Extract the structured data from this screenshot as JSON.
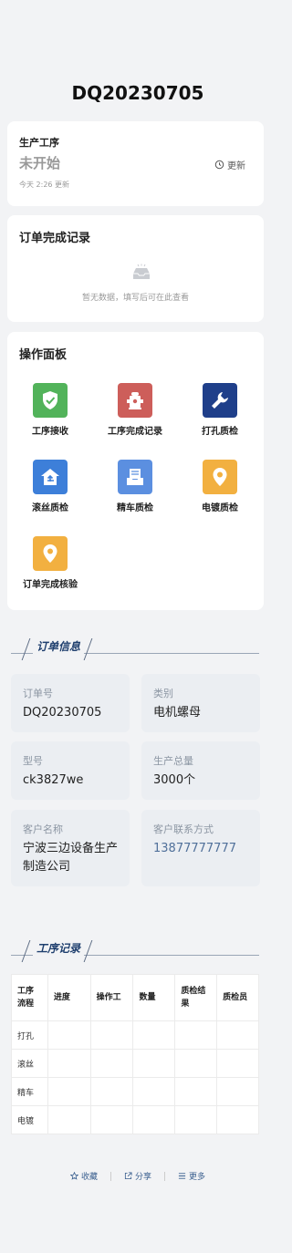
{
  "header": {
    "title": "DQ20230705"
  },
  "status": {
    "label": "生产工序",
    "value": "未开始",
    "time": "今天 2:26 更新",
    "refresh_label": "更新"
  },
  "records": {
    "title": "订单完成记录",
    "empty_text": "暂无数据，填写后可在此查看"
  },
  "operations": {
    "title": "操作面板",
    "items": [
      {
        "label": "工序接收",
        "icon": "shield-check-icon",
        "color": "#52b35a"
      },
      {
        "label": "工序完成记录",
        "icon": "hydrant-icon",
        "color": "#cd5e5a"
      },
      {
        "label": "打孔质检",
        "icon": "wrench-icon",
        "color": "#1f3f8a"
      },
      {
        "label": "滚丝质检",
        "icon": "house-upload-icon",
        "color": "#3d7fd9"
      },
      {
        "label": "精车质检",
        "icon": "document-tray-icon",
        "color": "#5b8fe0"
      },
      {
        "label": "电镀质检",
        "icon": "location-pin-icon",
        "color": "#f2b040"
      },
      {
        "label": "订单完成核验",
        "icon": "location-pin-icon",
        "color": "#f2b040"
      }
    ]
  },
  "order_info": {
    "section_title": "订单信息",
    "fields": [
      {
        "label": "订单号",
        "value": "DQ20230705"
      },
      {
        "label": "类别",
        "value": "电机螺母"
      },
      {
        "label": "型号",
        "value": "ck3827we"
      },
      {
        "label": "生产总量",
        "value": "3000个"
      },
      {
        "label": "客户名称",
        "value": "宁波三边设备生产制造公司"
      },
      {
        "label": "客户联系方式",
        "value": "13877777777"
      }
    ]
  },
  "process_records": {
    "section_title": "工序记录",
    "columns": [
      "工序流程",
      "进度",
      "操作工",
      "数量",
      "质检结果",
      "质检员"
    ],
    "rows": [
      [
        "打孔",
        "",
        "",
        "",
        "",
        ""
      ],
      [
        "滚丝",
        "",
        "",
        "",
        "",
        ""
      ],
      [
        "精车",
        "",
        "",
        "",
        "",
        ""
      ],
      [
        "电镀",
        "",
        "",
        "",
        "",
        ""
      ]
    ]
  },
  "footer": {
    "favorite_label": "收藏",
    "share_label": "分享",
    "more_label": "更多"
  }
}
